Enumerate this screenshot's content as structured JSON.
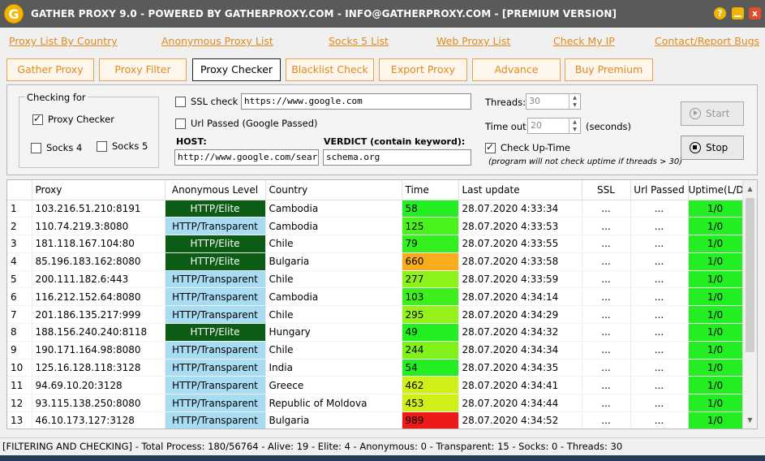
{
  "window": {
    "title": "GATHER PROXY 9.0 - POWERED BY GATHERPROXY.COM - INFO@GATHERPROXY.COM - [PREMIUM VERSION]",
    "logo_letter": "G",
    "help_glyph": "?",
    "close_glyph": "x"
  },
  "links": [
    "Proxy List By Country",
    "Anonymous Proxy List",
    "Socks 5 List",
    "Web Proxy List",
    "Check My IP",
    "Contact/Report Bugs"
  ],
  "tabs": [
    {
      "label": "Gather Proxy",
      "active": false
    },
    {
      "label": "Proxy Filter",
      "active": false
    },
    {
      "label": "Proxy Checker",
      "active": true
    },
    {
      "label": "Blacklist Check",
      "active": false
    },
    {
      "label": "Export Proxy",
      "active": false
    },
    {
      "label": "Advance",
      "active": false
    },
    {
      "label": "Buy Premium",
      "active": false
    }
  ],
  "settings": {
    "checking_for_title": "Checking for",
    "proxy_checker": {
      "label": "Proxy Checker",
      "checked": true
    },
    "socks4": {
      "label": "Socks 4",
      "checked": false
    },
    "socks5": {
      "label": "Socks 5",
      "checked": false
    },
    "ssl_check": {
      "label": "SSL check",
      "checked": false
    },
    "ssl_url": "https://www.google.com",
    "url_passed": {
      "label": "Url Passed (Google Passed)",
      "checked": false
    },
    "host_label": "HOST:",
    "host_value": "http://www.google.com/search?pv",
    "verdict_label": "VERDICT (contain keyword):",
    "verdict_value": "schema.org",
    "threads_label": "Threads:",
    "threads_value": "30",
    "timeout_label": "Time out:",
    "timeout_value": "20",
    "seconds_label": "(seconds)",
    "check_uptime": {
      "label": "Check Up-Time",
      "checked": true
    },
    "uptime_note": "(program will not check uptime if threads > 30)",
    "start_label": "Start",
    "stop_label": "Stop"
  },
  "table": {
    "headers": [
      "",
      "Proxy",
      "Anonymous Level",
      "Country",
      "Time",
      "Last update",
      "SSL",
      "Url Passed",
      "Uptime(L/D)"
    ],
    "rows": [
      {
        "n": "1",
        "proxy": "103.216.51.210:8191",
        "level": "HTTP/Elite",
        "country": "Cambodia",
        "time": "58",
        "time_color": "#22ee22",
        "updated": "28.07.2020 4:33:34",
        "ssl": "...",
        "url_passed": "...",
        "uptime": "1/0"
      },
      {
        "n": "2",
        "proxy": "110.74.219.3:8080",
        "level": "HTTP/Transparent",
        "country": "Cambodia",
        "time": "125",
        "time_color": "#4af21c",
        "updated": "28.07.2020 4:33:53",
        "ssl": "...",
        "url_passed": "...",
        "uptime": "1/0"
      },
      {
        "n": "3",
        "proxy": "181.118.167.104:80",
        "level": "HTTP/Elite",
        "country": "Chile",
        "time": "79",
        "time_color": "#33ef1e",
        "updated": "28.07.2020 4:33:55",
        "ssl": "...",
        "url_passed": "...",
        "uptime": "1/0"
      },
      {
        "n": "4",
        "proxy": "85.196.183.162:8080",
        "level": "HTTP/Elite",
        "country": "Bulgaria",
        "time": "660",
        "time_color": "#f8ae1c",
        "updated": "28.07.2020 4:33:58",
        "ssl": "...",
        "url_passed": "...",
        "uptime": "1/0"
      },
      {
        "n": "5",
        "proxy": "200.111.182.6:443",
        "level": "HTTP/Transparent",
        "country": "Chile",
        "time": "277",
        "time_color": "#8cf21a",
        "updated": "28.07.2020 4:33:59",
        "ssl": "...",
        "url_passed": "...",
        "uptime": "1/0"
      },
      {
        "n": "6",
        "proxy": "116.212.152.64:8080",
        "level": "HTTP/Transparent",
        "country": "Cambodia",
        "time": "103",
        "time_color": "#3def1d",
        "updated": "28.07.2020 4:34:14",
        "ssl": "...",
        "url_passed": "...",
        "uptime": "1/0"
      },
      {
        "n": "7",
        "proxy": "201.186.135.217:999",
        "level": "HTTP/Transparent",
        "country": "Chile",
        "time": "295",
        "time_color": "#94f21a",
        "updated": "28.07.2020 4:34:29",
        "ssl": "...",
        "url_passed": "...",
        "uptime": "1/0"
      },
      {
        "n": "8",
        "proxy": "188.156.240.240:8118",
        "level": "HTTP/Elite",
        "country": "Hungary",
        "time": "49",
        "time_color": "#22ee22",
        "updated": "28.07.2020 4:34:32",
        "ssl": "...",
        "url_passed": "...",
        "uptime": "1/0"
      },
      {
        "n": "9",
        "proxy": "190.171.164.98:8080",
        "level": "HTTP/Transparent",
        "country": "Chile",
        "time": "244",
        "time_color": "#7ff21a",
        "updated": "28.07.2020 4:34:34",
        "ssl": "...",
        "url_passed": "...",
        "uptime": "1/0"
      },
      {
        "n": "10",
        "proxy": "125.16.128.118:3128",
        "level": "HTTP/Transparent",
        "country": "India",
        "time": "54",
        "time_color": "#22ee22",
        "updated": "28.07.2020 4:34:35",
        "ssl": "...",
        "url_passed": "...",
        "uptime": "1/0"
      },
      {
        "n": "11",
        "proxy": "94.69.10.20:3128",
        "level": "HTTP/Transparent",
        "country": "Greece",
        "time": "462",
        "time_color": "#d2ef18",
        "updated": "28.07.2020 4:34:41",
        "ssl": "...",
        "url_passed": "...",
        "uptime": "1/0"
      },
      {
        "n": "12",
        "proxy": "93.115.138.250:8080",
        "level": "HTTP/Transparent",
        "country": "Republic of Moldova",
        "time": "453",
        "time_color": "#ceef18",
        "updated": "28.07.2020 4:34:44",
        "ssl": "...",
        "url_passed": "...",
        "uptime": "1/0"
      },
      {
        "n": "13",
        "proxy": "46.10.173.127:3128",
        "level": "HTTP/Transparent",
        "country": "Bulgaria",
        "time": "989",
        "time_color": "#ee1a1a",
        "updated": "28.07.2020 4:34:52",
        "ssl": "...",
        "url_passed": "...",
        "uptime": "1/0"
      }
    ]
  },
  "status": "[FILTERING AND CHECKING] - Total Process: 180/56764 - Alive: 19 - Elite: 4 - Anonymous: 0 - Transparent: 15 - Socks: 0 - Threads: 30"
}
